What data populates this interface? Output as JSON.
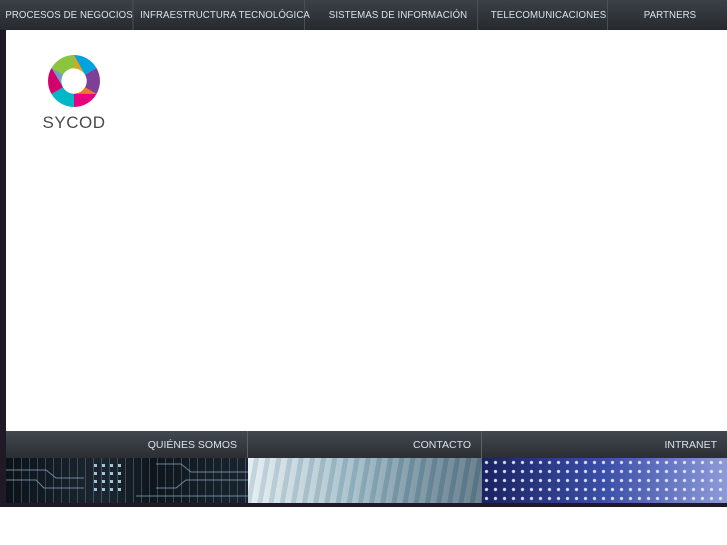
{
  "topnav": {
    "items": [
      {
        "label": "PROCESOS DE NEGOCIOS"
      },
      {
        "label": "INFRAESTRUCTURA TECNOLÓGICA"
      },
      {
        "label": "SISTEMAS DE INFORMACIÓN"
      },
      {
        "label": "TELECOMUNICACIONES"
      },
      {
        "label": "PARTNERS"
      }
    ]
  },
  "logo": {
    "wordmark": "SYCOD",
    "colors": [
      "#e6007e",
      "#8bc53f",
      "#00a3e0",
      "#f7a800",
      "#7e3f98"
    ]
  },
  "bottomnav": {
    "items": [
      {
        "label": "QUIÉNES SOMOS"
      },
      {
        "label": "CONTACTO"
      },
      {
        "label": "INTRANET"
      }
    ]
  },
  "strip": {
    "panels": [
      "circuit-board-image",
      "keyboard-image",
      "dots-pattern-image"
    ]
  }
}
